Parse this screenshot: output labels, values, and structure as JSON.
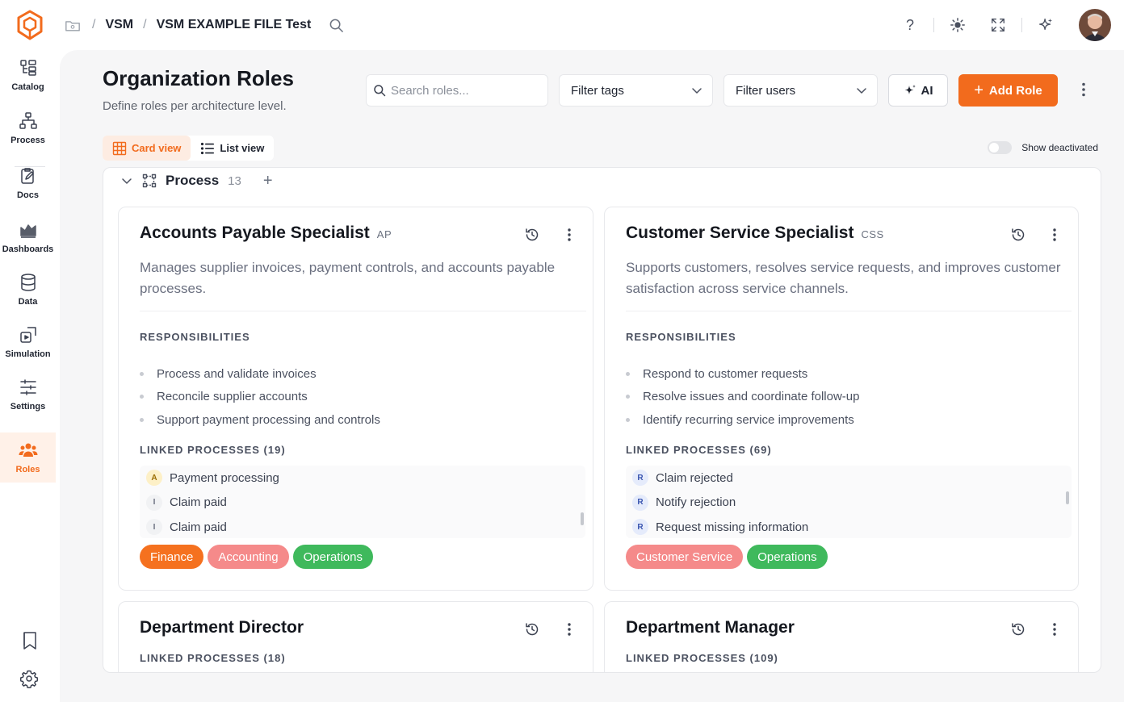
{
  "breadcrumb": [
    "VSM",
    "VSM EXAMPLE FILE Test"
  ],
  "sidebar": {
    "items": [
      {
        "id": "catalog",
        "label": "Catalog",
        "icon": "catalog-icon"
      },
      {
        "id": "process",
        "label": "Process",
        "icon": "process-icon"
      },
      {
        "id": "docs",
        "label": "Docs",
        "icon": "docs-icon"
      },
      {
        "id": "dashboards",
        "label": "Dashboards",
        "icon": "dashboard-icon"
      },
      {
        "id": "data",
        "label": "Data",
        "icon": "database-icon"
      },
      {
        "id": "simulation",
        "label": "Simulation",
        "icon": "simulation-icon"
      },
      {
        "id": "settings",
        "label": "Settings",
        "icon": "sliders-icon"
      },
      {
        "id": "roles",
        "label": "Roles",
        "icon": "users-icon",
        "active": true
      }
    ]
  },
  "page": {
    "title": "Organization Roles",
    "subtitle": "Define roles per architecture level.",
    "search_placeholder": "Search roles...",
    "filter_tags": "Filter tags",
    "filter_users": "Filter users",
    "ai_label": "AI",
    "add_role_label": "Add Role",
    "card_view_label": "Card view",
    "list_view_label": "List view",
    "show_deactivated_label": "Show deactivated",
    "show_deactivated": false
  },
  "section": {
    "name": "Process",
    "count": "13"
  },
  "labels": {
    "responsibilities": "RESPONSIBILITIES"
  },
  "colors": {
    "accent": "#f26b1d",
    "tag_finance": "#f5711f",
    "tag_accounting": "#f58a8a",
    "tag_operations": "#3fb95c",
    "tag_customer_service": "#f58a8a"
  },
  "cards": [
    {
      "title": "Accounts Payable Specialist",
      "abbr": "AP",
      "description": "Manages supplier invoices, payment controls, and accounts payable processes.",
      "responsibilities": [
        "Process and validate invoices",
        "Reconcile supplier accounts",
        "Support payment processing and controls"
      ],
      "linked_label": "LINKED PROCESSES (19)",
      "linked": [
        {
          "badge": "A",
          "name": "Payment processing"
        },
        {
          "badge": "I",
          "name": "Claim paid"
        },
        {
          "badge": "I",
          "name": "Claim paid"
        }
      ],
      "tags": [
        {
          "label": "Finance",
          "color": "#f5711f"
        },
        {
          "label": "Accounting",
          "color": "#f58a8a"
        },
        {
          "label": "Operations",
          "color": "#3fb95c"
        }
      ]
    },
    {
      "title": "Customer Service Specialist",
      "abbr": "CSS",
      "description": "Supports customers, resolves service requests, and improves customer satisfaction across service channels.",
      "responsibilities": [
        "Respond to customer requests",
        "Resolve issues and coordinate follow-up",
        "Identify recurring service improvements"
      ],
      "linked_label": "LINKED PROCESSES (69)",
      "linked": [
        {
          "badge": "R",
          "name": "Claim rejected"
        },
        {
          "badge": "R",
          "name": "Notify rejection"
        },
        {
          "badge": "R",
          "name": "Request missing information"
        }
      ],
      "tags": [
        {
          "label": "Customer Service",
          "color": "#f58a8a"
        },
        {
          "label": "Operations",
          "color": "#3fb95c"
        }
      ]
    },
    {
      "title": "Department Director",
      "linked_label": "LINKED PROCESSES (18)"
    },
    {
      "title": "Department Manager",
      "linked_label": "LINKED PROCESSES (109)"
    }
  ]
}
